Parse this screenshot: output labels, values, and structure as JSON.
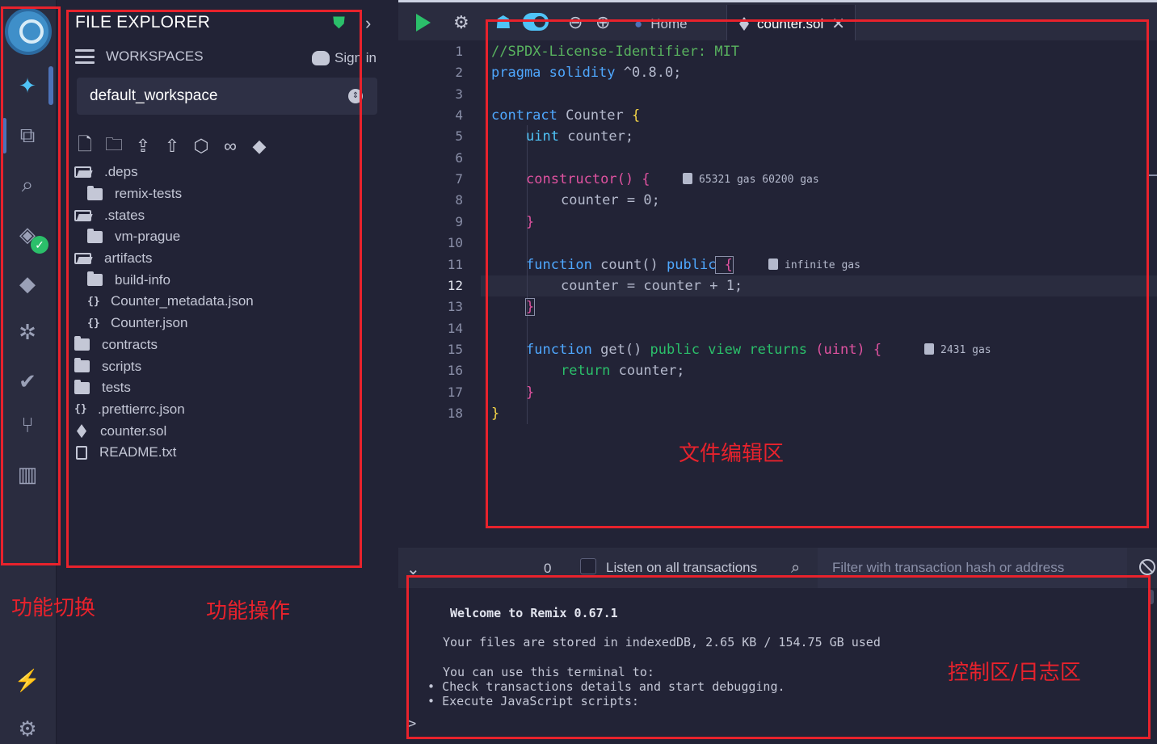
{
  "sidebar": {
    "icons": [
      "remix-logo-icon",
      "ai-icon",
      "file-explorer-icon",
      "search-icon",
      "solidity-compiler-icon",
      "deploy-icon",
      "debugger-icon",
      "unit-test-icon",
      "git-icon",
      "learn-icon",
      "plugin-manager-icon",
      "settings-icon"
    ]
  },
  "panel": {
    "title": "FILE EXPLORER",
    "workspaces_label": "WORKSPACES",
    "signin_label": "Sign in",
    "workspace_selected": "default_workspace",
    "tree": [
      {
        "name": ".deps",
        "kind": "folder-open",
        "depth": 0
      },
      {
        "name": "remix-tests",
        "kind": "folder",
        "depth": 1
      },
      {
        "name": ".states",
        "kind": "folder-open",
        "depth": 0
      },
      {
        "name": "vm-prague",
        "kind": "folder",
        "depth": 1
      },
      {
        "name": "artifacts",
        "kind": "folder-open",
        "depth": 0
      },
      {
        "name": "build-info",
        "kind": "folder",
        "depth": 1
      },
      {
        "name": "Counter_metadata.json",
        "kind": "json",
        "depth": 1
      },
      {
        "name": "Counter.json",
        "kind": "json",
        "depth": 1
      },
      {
        "name": "contracts",
        "kind": "folder",
        "depth": 0
      },
      {
        "name": "scripts",
        "kind": "folder",
        "depth": 0
      },
      {
        "name": "tests",
        "kind": "folder",
        "depth": 0
      },
      {
        "name": ".prettierrc.json",
        "kind": "json",
        "depth": 0
      },
      {
        "name": "counter.sol",
        "kind": "sol",
        "depth": 0
      },
      {
        "name": "README.txt",
        "kind": "txt",
        "depth": 0
      }
    ]
  },
  "tabs": {
    "home": "Home",
    "active": "counter.sol"
  },
  "editor": {
    "current_line": 12,
    "line_numbers": [
      "1",
      "2",
      "3",
      "4",
      "5",
      "6",
      "7",
      "8",
      "9",
      "10",
      "11",
      "12",
      "13",
      "14",
      "15",
      "16",
      "17",
      "18"
    ],
    "lines": {
      "l1": "//SPDX-License-Identifier: MIT",
      "l2_kw": "pragma solidity",
      "l2_ver": " ^0.8.0;",
      "l4_kw": "contract",
      "l4_name": " Counter ",
      "l5_type": "uint",
      "l5_rest": " counter;",
      "l7_fn": "constructor()",
      "l8": "counter = 0;",
      "l11_kw": "function",
      "l11_name": " count()",
      "l11_pub": " public",
      "l12": "counter = counter + 1;",
      "l15_kw": "function",
      "l15_name": " get()",
      "l15_mods": " public view returns",
      "l15_ret": " (uint)",
      "l16_kw": "return",
      "l16_rest": " counter;"
    },
    "gas": {
      "constructor": "65321 gas 60200 gas",
      "count": "infinite gas",
      "get": "2431 gas"
    }
  },
  "terminal": {
    "count": "0",
    "listen_label": "Listen on all transactions",
    "filter_placeholder": "Filter with transaction hash or address",
    "welcome": "Welcome to Remix 0.67.1",
    "storage": "Your files are stored in indexedDB, 2.65 KB / 154.75 GB used",
    "use_intro": "You can use this terminal to:",
    "bullet1": "Check transactions details and start debugging.",
    "bullet2": "Execute JavaScript scripts:",
    "prompt": ">"
  },
  "annotations": {
    "icon_bar": "功能切换",
    "side_panel": "功能操作",
    "editor": "文件编辑区",
    "terminal": "控制区/日志区",
    "color": "#e8222c"
  }
}
